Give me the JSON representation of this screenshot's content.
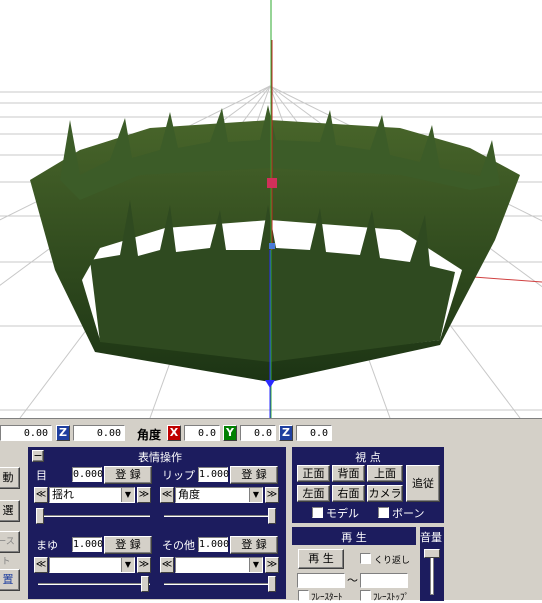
{
  "coords": {
    "position_x": "0.00",
    "axis_z_label": "Z",
    "position_z": "0.00",
    "angle_label": "角度",
    "axis_x_label": "X",
    "angle_x": "0.0",
    "axis_y_label": "Y",
    "angle_y": "0.0",
    "angle_z": "0.0"
  },
  "left_edge": {
    "btn1": "動",
    "btn2": "選",
    "btn3": "ースト",
    "btn4": "置"
  },
  "expression": {
    "collapse": "−",
    "title": "表情操作",
    "eye": {
      "label": "目",
      "value": "0.000",
      "register": "登 録",
      "selected": "揺れ"
    },
    "lip": {
      "label": "リップ",
      "value": "1.000",
      "register": "登 録",
      "selected": "角度"
    },
    "brow": {
      "label": "まゆ",
      "value": "1.000",
      "register": "登 録",
      "selected": ""
    },
    "other": {
      "label": "その他",
      "value": "1.000",
      "register": "登 録",
      "selected": ""
    },
    "arrow_left": "≪",
    "arrow_right": "≫",
    "dropdown_glyph": "▼"
  },
  "view": {
    "title": "視 点",
    "front": "正面",
    "back": "背面",
    "top": "上面",
    "left": "左面",
    "right": "右面",
    "camera": "カメラ",
    "follow": "追従",
    "model_check": "モデル",
    "bone_check": "ボーン"
  },
  "playback": {
    "title": "再 生",
    "play": "再 生",
    "loop": "くり返し",
    "tilde": "〜",
    "frame_start": "ﾌﾚｰｽﾀｰﾄ",
    "frame_stop": "ﾌﾚｰｽﾄｯﾌﾟ"
  },
  "volume": {
    "title": "音量"
  }
}
